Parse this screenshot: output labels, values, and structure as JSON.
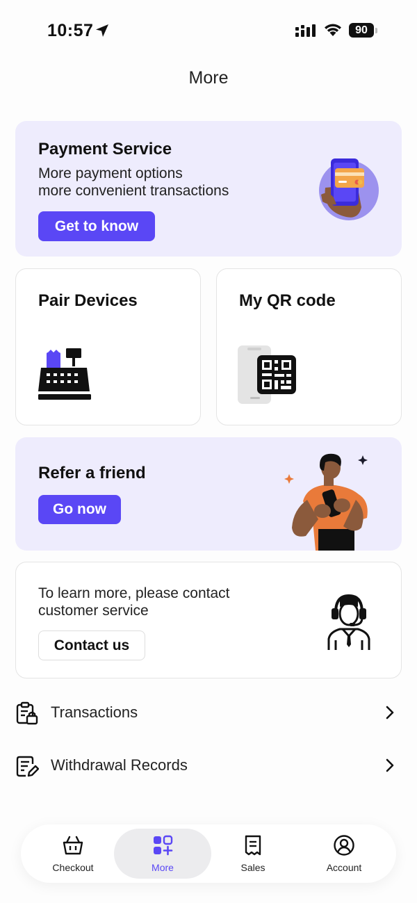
{
  "status": {
    "time": "10:57",
    "battery": "90"
  },
  "page": {
    "title": "More"
  },
  "payment": {
    "title": "Payment Service",
    "line1": "More payment options",
    "line2": "more convenient transactions",
    "button": "Get to know"
  },
  "pair": {
    "title": "Pair Devices"
  },
  "qr": {
    "title": "My QR code"
  },
  "refer": {
    "title": "Refer a friend",
    "button": "Go now"
  },
  "contact": {
    "line1": "To learn more, please contact",
    "line2": "customer service",
    "button": "Contact us"
  },
  "list": [
    {
      "label": "Transactions",
      "icon": "clipboard-lock-icon"
    },
    {
      "label": "Withdrawal Records",
      "icon": "document-edit-icon"
    }
  ],
  "tabs": [
    {
      "label": "Checkout",
      "icon": "basket-icon"
    },
    {
      "label": "More",
      "icon": "grid-plus-icon",
      "active": true
    },
    {
      "label": "Sales",
      "icon": "receipt-icon"
    },
    {
      "label": "Account",
      "icon": "user-circle-icon"
    }
  ],
  "colors": {
    "accent": "#5a47f5",
    "card_purple": "#eeecfd",
    "skin": "#8b5a3c",
    "orange": "#e97a3a"
  }
}
